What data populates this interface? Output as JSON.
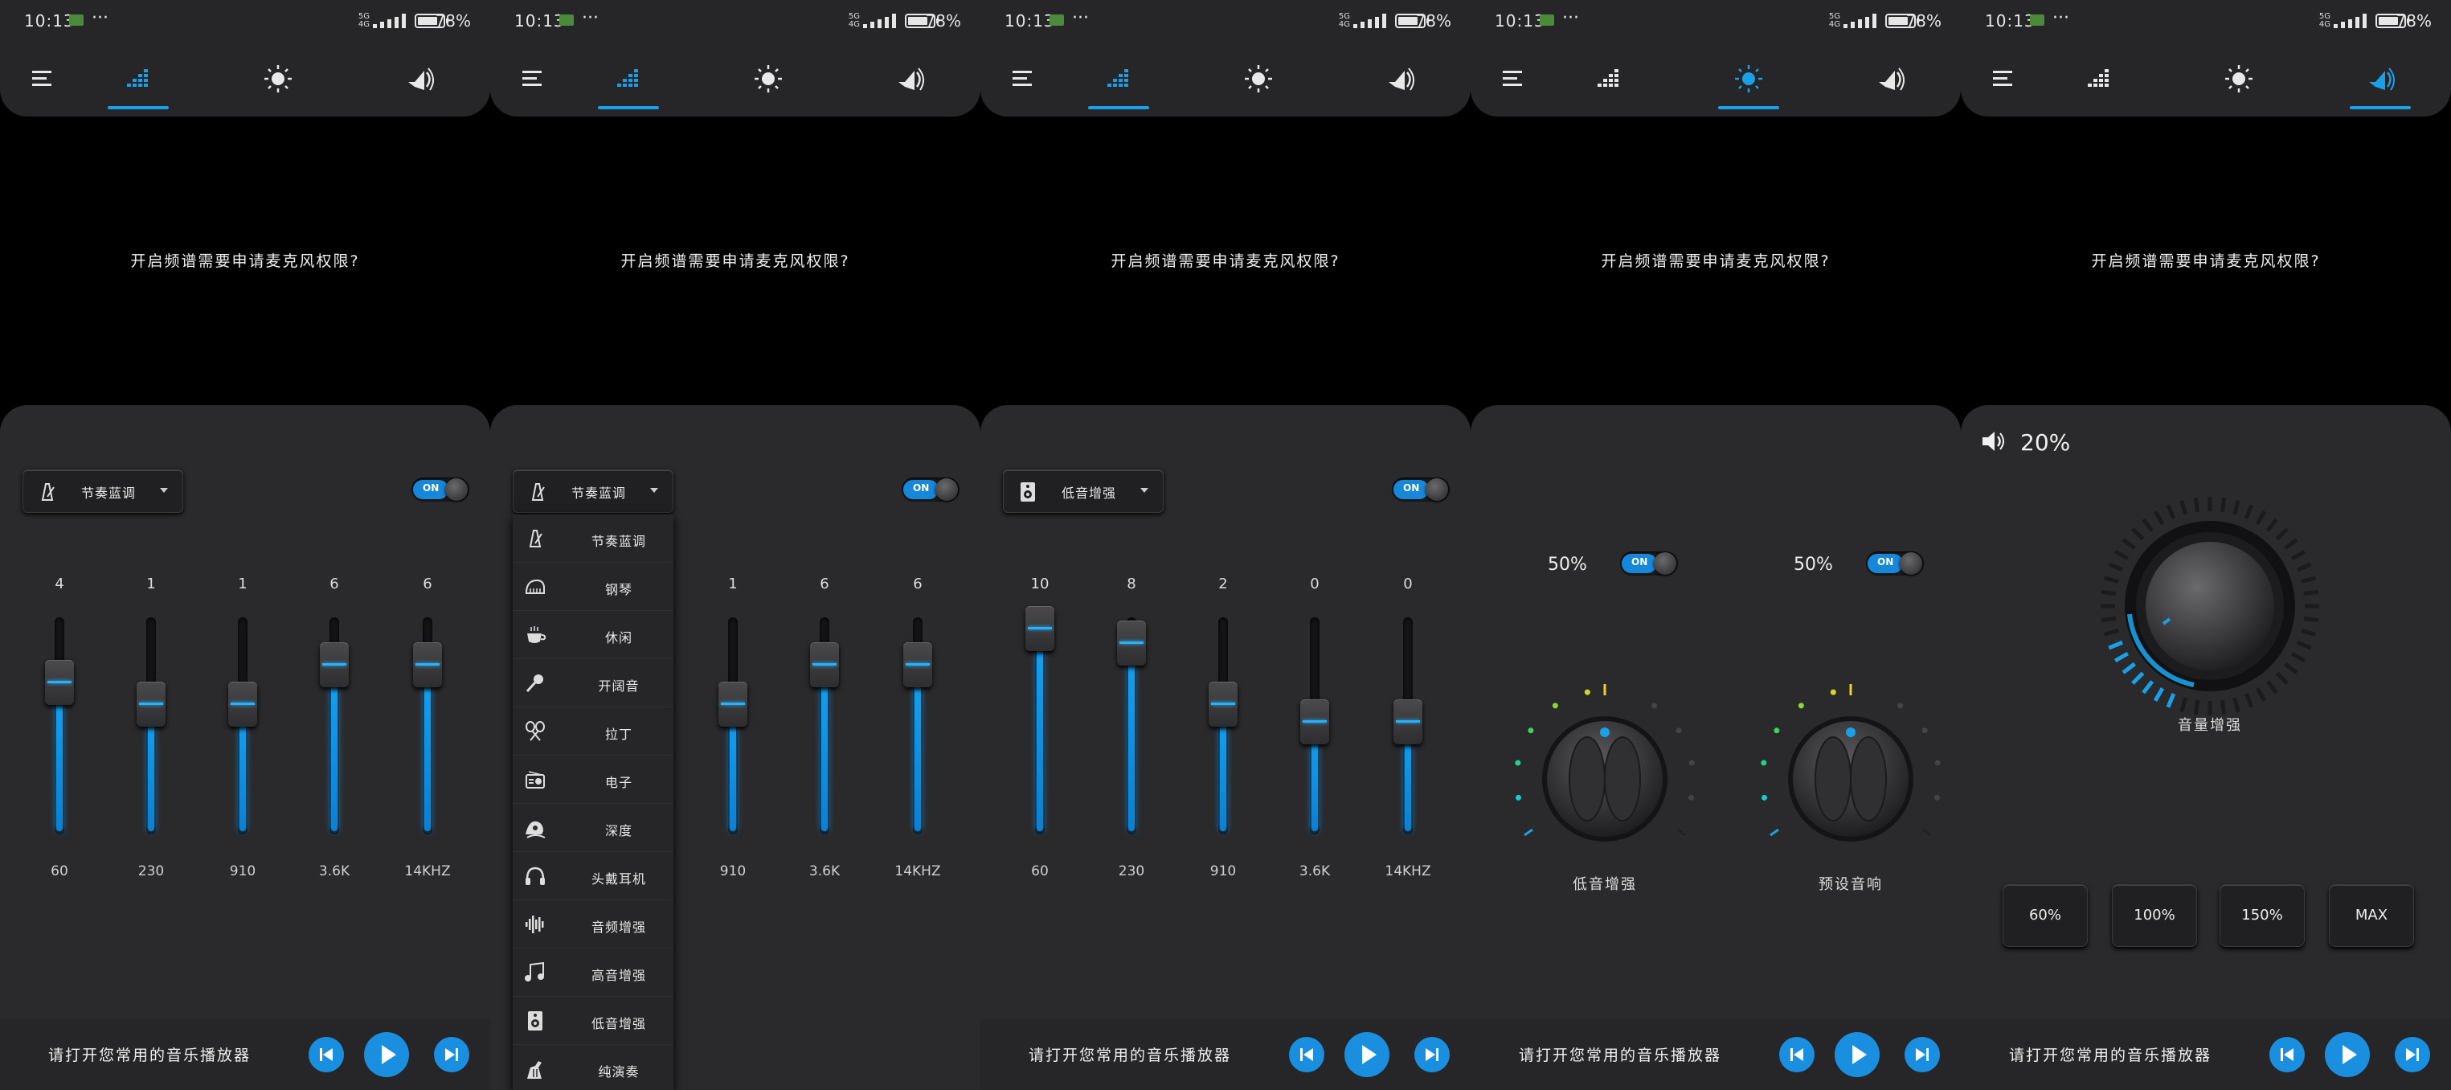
{
  "status": {
    "time": "10:13",
    "dots": "···",
    "battery": "78%",
    "net_top": "5G",
    "net_bottom": "4G"
  },
  "prompt": "开启频谱需要申请麦克风权限?",
  "player": {
    "text": "请打开您常用的音乐播放器"
  },
  "toggle_on": "ON",
  "screens": [
    {
      "preset": "节奏蓝调",
      "bands": [
        {
          "value": "4",
          "freq": "60",
          "level": 0.7
        },
        {
          "value": "1",
          "freq": "230",
          "level": 0.6
        },
        {
          "value": "1",
          "freq": "910",
          "level": 0.6
        },
        {
          "value": "6",
          "freq": "3.6K",
          "level": 0.78
        },
        {
          "value": "6",
          "freq": "14KHZ",
          "level": 0.78
        }
      ]
    },
    {
      "preset": "节奏蓝调",
      "bands": [
        {
          "value": "1",
          "freq": "910",
          "level": 0.6
        },
        {
          "value": "6",
          "freq": "3.6K",
          "level": 0.78
        },
        {
          "value": "6",
          "freq": "14KHZ",
          "level": 0.78
        }
      ],
      "dropdown": [
        "节奏蓝调",
        "钢琴",
        "休闲",
        "开阔音",
        "拉丁",
        "电子",
        "深度",
        "头戴耳机",
        "音频增强",
        "高音增强",
        "低音增强",
        "纯演奏"
      ]
    },
    {
      "preset": "低音增强",
      "bands": [
        {
          "value": "10",
          "freq": "60",
          "level": 0.95
        },
        {
          "value": "8",
          "freq": "230",
          "level": 0.88
        },
        {
          "value": "2",
          "freq": "910",
          "level": 0.6
        },
        {
          "value": "0",
          "freq": "3.6K",
          "level": 0.52
        },
        {
          "value": "0",
          "freq": "14KHZ",
          "level": 0.52
        }
      ]
    },
    {
      "knobs": [
        {
          "pct": "50%",
          "label": "低音增强"
        },
        {
          "pct": "50%",
          "label": "预设音响"
        }
      ]
    },
    {
      "volume": "20%",
      "knob_label": "音量增强",
      "boost": [
        "60%",
        "100%",
        "150%",
        "MAX"
      ]
    }
  ]
}
